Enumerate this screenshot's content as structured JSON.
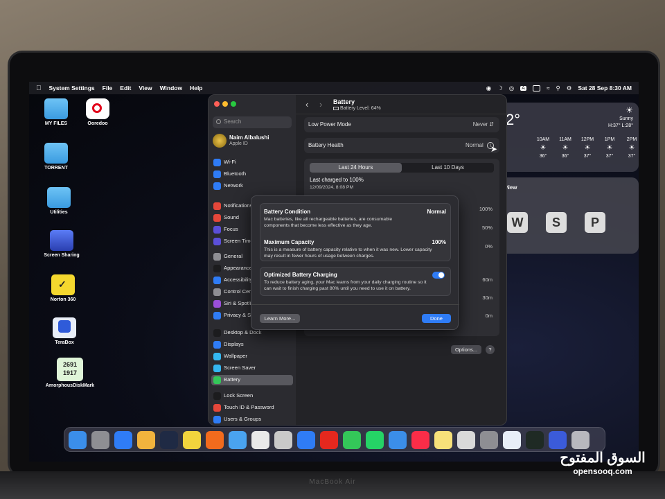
{
  "menubar": {
    "app": "System Settings",
    "menus": [
      "File",
      "Edit",
      "View",
      "Window",
      "Help"
    ],
    "datetime": "Sat 28 Sep  8:30 AM",
    "status_icons": [
      "creative-cloud-icon",
      "moon-icon",
      "vpn-icon",
      "input-a-icon",
      "battery-icon",
      "wifi-icon",
      "search-icon",
      "control-center-icon"
    ]
  },
  "desktop": {
    "icons": [
      {
        "label": "MY FILES",
        "type": "folder"
      },
      {
        "label": "Ooredoo",
        "type": "app"
      },
      {
        "label": "TORRENT",
        "type": "folder"
      },
      {
        "label": "Utilities",
        "type": "folder"
      },
      {
        "label": "Screen Sharing",
        "type": "app"
      },
      {
        "label": "Norton 360",
        "type": "app"
      },
      {
        "label": "TeraBox",
        "type": "app"
      },
      {
        "label": "AmorphousDiskMark",
        "type": "app"
      }
    ],
    "diskmark_values": [
      "2691",
      "1917"
    ]
  },
  "weather": {
    "temp_partial": "2°",
    "condition": "Sunny",
    "hilo": "H:37° L:28°",
    "hours": [
      {
        "t": "10AM",
        "v": "36°"
      },
      {
        "t": "11AM",
        "v": "36°"
      },
      {
        "t": "12PM",
        "v": "37°"
      },
      {
        "t": "1PM",
        "v": "37°"
      },
      {
        "t": "2PM",
        "v": "37°"
      }
    ]
  },
  "notes_widget": {
    "label": "New",
    "letters": [
      "W",
      "S",
      "P"
    ]
  },
  "settings": {
    "search_placeholder": "Search",
    "user_name": "Naim Albalushi",
    "user_sub": "Apple ID",
    "sidebar": [
      {
        "label": "Wi-Fi",
        "color": "#2f7cf6"
      },
      {
        "label": "Bluetooth",
        "color": "#2f7cf6"
      },
      {
        "label": "Network",
        "color": "#2f7cf6"
      },
      {
        "label": "Notifications",
        "color": "#e5473a"
      },
      {
        "label": "Sound",
        "color": "#e5473a"
      },
      {
        "label": "Focus",
        "color": "#5b4fd9"
      },
      {
        "label": "Screen Time",
        "color": "#5b4fd9"
      },
      {
        "label": "General",
        "color": "#8e8e93"
      },
      {
        "label": "Appearance",
        "color": "#1c1c1e"
      },
      {
        "label": "Accessibility",
        "color": "#2f7cf6"
      },
      {
        "label": "Control Centre",
        "color": "#8e8e93"
      },
      {
        "label": "Siri & Spotlight",
        "color": "#9b4fd9"
      },
      {
        "label": "Privacy & Security",
        "color": "#2f7cf6"
      },
      {
        "label": "Desktop & Dock",
        "color": "#1c1c1e"
      },
      {
        "label": "Displays",
        "color": "#2f7cf6"
      },
      {
        "label": "Wallpaper",
        "color": "#34b7f0"
      },
      {
        "label": "Screen Saver",
        "color": "#34b7f0"
      },
      {
        "label": "Battery",
        "color": "#34c759"
      },
      {
        "label": "Lock Screen",
        "color": "#1c1c1e"
      },
      {
        "label": "Touch ID & Password",
        "color": "#e5473a"
      },
      {
        "label": "Users & Groups",
        "color": "#2f7cf6"
      }
    ],
    "header": {
      "title": "Battery",
      "subtitle": "Battery Level: 64%"
    },
    "low_power": {
      "label": "Low Power Mode",
      "value": "Never"
    },
    "health": {
      "label": "Battery Health",
      "value": "Normal"
    },
    "tabs": [
      "Last 24 Hours",
      "Last 10 Days"
    ],
    "last_charged": "Last charged to 100%",
    "last_charged_time": "12/09/2024, 8:08 PM",
    "level_axis": [
      "100%",
      "50%",
      "0%"
    ],
    "usage_axis": [
      "60m",
      "30m",
      "0m"
    ],
    "options_button": "Options...",
    "help_button": "?"
  },
  "modal": {
    "condition_title": "Battery Condition",
    "condition_value": "Normal",
    "condition_text": "Mac batteries, like all rechargeable batteries, are consumable components that become less effective as they age.",
    "capacity_title": "Maximum Capacity",
    "capacity_value": "100%",
    "capacity_text": "This is a measure of battery capacity relative to when it was new. Lower capacity may result in fewer hours of usage between charges.",
    "optimized_title": "Optimized Battery Charging",
    "optimized_text": "To reduce battery aging, your Mac learns from your daily charging routine so it can wait to finish charging past 80% until you need to use it on battery.",
    "learn_more": "Learn More...",
    "done": "Done"
  },
  "dock": {
    "apps": [
      {
        "name": "finder-icon",
        "color": "#3b8eea"
      },
      {
        "name": "launchpad-icon",
        "color": "#8e8e93"
      },
      {
        "name": "app-store-icon",
        "color": "#2f7cf6"
      },
      {
        "name": "photos-icon",
        "color": "#f2b33d"
      },
      {
        "name": "speedtest-icon",
        "color": "#1f2a44"
      },
      {
        "name": "norton-icon",
        "color": "#f2d43d"
      },
      {
        "name": "brave-icon",
        "color": "#f26b1d"
      },
      {
        "name": "safari-icon",
        "color": "#4aa3f0"
      },
      {
        "name": "chrome-icon",
        "color": "#e9e9e9"
      },
      {
        "name": "preview-icon",
        "color": "#c9c9c9"
      },
      {
        "name": "safari-blue-icon",
        "color": "#2f7cf6"
      },
      {
        "name": "youtube-icon",
        "color": "#e5281e"
      },
      {
        "name": "facetime-icon",
        "color": "#34c759"
      },
      {
        "name": "whatsapp-icon",
        "color": "#25d366"
      },
      {
        "name": "mail-icon",
        "color": "#3b8eea"
      },
      {
        "name": "music-icon",
        "color": "#fa2d48"
      },
      {
        "name": "notes-icon",
        "color": "#f7e17a"
      },
      {
        "name": "preview-doc-icon",
        "color": "#d9d9d9"
      },
      {
        "name": "system-settings-icon",
        "color": "#8e8e93"
      },
      {
        "name": "terabox-icon",
        "color": "#e8eef8"
      },
      {
        "name": "activity-monitor-icon",
        "color": "#1f2a24"
      },
      {
        "name": "screen-sharing-icon",
        "color": "#3b5bd9"
      },
      {
        "name": "trash-icon",
        "color": "#b8b8be"
      }
    ]
  },
  "watermark": {
    "arabic": "السوق المفتوح",
    "latin": "opensooq.com"
  },
  "case_label": "MacBook Air"
}
